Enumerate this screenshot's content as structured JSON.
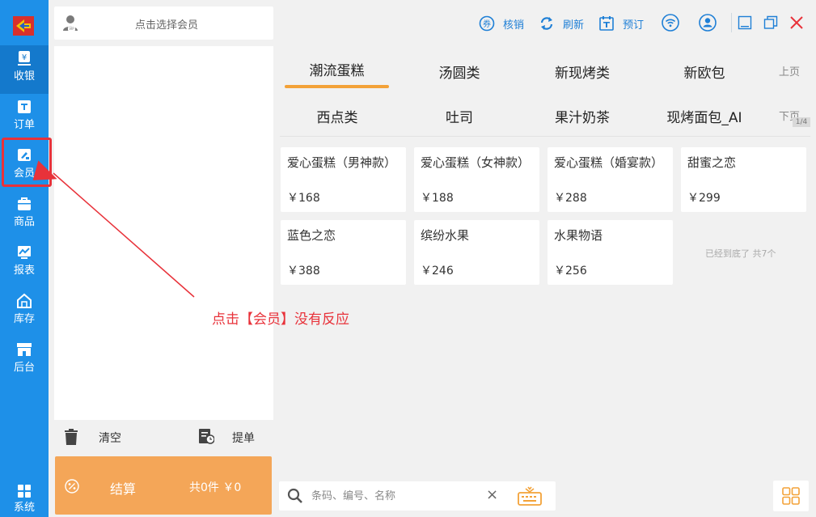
{
  "sidebar": {
    "items": [
      {
        "label": "收银",
        "icon": "cashier-icon"
      },
      {
        "label": "订单",
        "icon": "order-icon"
      },
      {
        "label": "会员",
        "icon": "member-card-icon"
      },
      {
        "label": "商品",
        "icon": "goods-bag-icon"
      },
      {
        "label": "报表",
        "icon": "report-chart-icon"
      },
      {
        "label": "库存",
        "icon": "warehouse-icon"
      },
      {
        "label": "后台",
        "icon": "backend-store-icon"
      }
    ],
    "system_label": "系统"
  },
  "member": {
    "placeholder": "点击选择会员"
  },
  "toolbar": {
    "verify": "核销",
    "refresh": "刷新",
    "reserve": "预订"
  },
  "categories": {
    "row1": [
      "潮流蛋糕",
      "汤圆类",
      "新现烤类",
      "新欧包"
    ],
    "row2": [
      "西点类",
      "吐司",
      "果汁奶茶",
      "现烤面包_AI"
    ],
    "prev_page": "上页",
    "next_page": "下页",
    "page_indicator": "1/4"
  },
  "products": [
    {
      "name": "爱心蛋糕（男神款）",
      "price": "￥168"
    },
    {
      "name": "爱心蛋糕（女神款）",
      "price": "￥188"
    },
    {
      "name": "爱心蛋糕（婚宴款）",
      "price": "￥288"
    },
    {
      "name": "甜蜜之恋",
      "price": "￥299"
    },
    {
      "name": "蓝色之恋",
      "price": "￥388"
    },
    {
      "name": "缤纷水果",
      "price": "￥246"
    },
    {
      "name": "水果物语",
      "price": "￥256"
    }
  ],
  "end_of_list": "已经到底了 共7个",
  "cart_actions": {
    "clear": "清空",
    "bill": "提单"
  },
  "checkout": {
    "label": "结算",
    "summary": "共0件 ￥0"
  },
  "search": {
    "placeholder": "条码、编号、名称"
  },
  "annotation": "点击【会员】没有反应",
  "colors": {
    "sidebar": "#1e90e8",
    "accent": "#f3a238",
    "checkout": "#f4a658",
    "annotation": "#e8323a",
    "link": "#1e7fd6"
  }
}
